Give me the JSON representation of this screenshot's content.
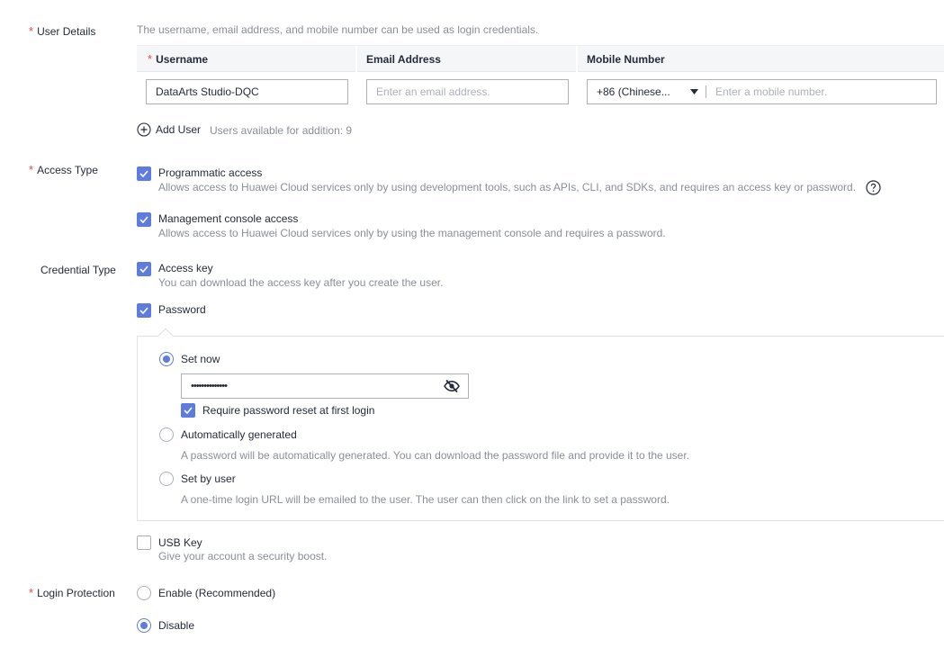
{
  "user_details": {
    "label": "User Details",
    "hint": "The username, email address, and mobile number can be used as login credentials.",
    "columns": {
      "username": "Username",
      "email": "Email Address",
      "mobile": "Mobile Number"
    },
    "row": {
      "username_value": "DataArts Studio-DQC",
      "email_placeholder": "Enter an email address.",
      "country_code": "+86 (Chinese...",
      "mobile_placeholder": "Enter a mobile number."
    },
    "add_user_label": "Add User",
    "available_text": "Users available for addition: 9"
  },
  "access_type": {
    "label": "Access Type",
    "programmatic": {
      "title": "Programmatic access",
      "desc": "Allows access to Huawei Cloud services only by using development tools, such as APIs, CLI, and SDKs, and requires an access key or password.",
      "checked": true
    },
    "console": {
      "title": "Management console access",
      "desc": "Allows access to Huawei Cloud services only by using the management console and requires a password.",
      "checked": true
    }
  },
  "credential_type": {
    "label": "Credential Type",
    "access_key": {
      "title": "Access key",
      "desc": "You can download the access key after you create the user.",
      "checked": true
    },
    "password": {
      "title": "Password",
      "checked": true
    },
    "set_now": {
      "label": "Set now",
      "selected": true,
      "password_mask": "••••••••••••••",
      "require_reset_label": "Require password reset at first login",
      "require_reset_checked": true
    },
    "auto_generated": {
      "label": "Automatically generated",
      "desc": "A password will be automatically generated. You can download the password file and provide it to the user."
    },
    "set_by_user": {
      "label": "Set by user",
      "desc": "A one-time login URL will be emailed to the user. The user can then click on the link to set a password."
    },
    "usb_key": {
      "title": "USB Key",
      "desc": "Give your account a security boost.",
      "checked": false
    }
  },
  "login_protection": {
    "label": "Login Protection",
    "enable_label": "Enable (Recommended)",
    "disable_label": "Disable",
    "selected": "Disable"
  },
  "colors": {
    "accent": "#5e7ce0",
    "required": "#e54545",
    "hint": "#8a8e99"
  }
}
